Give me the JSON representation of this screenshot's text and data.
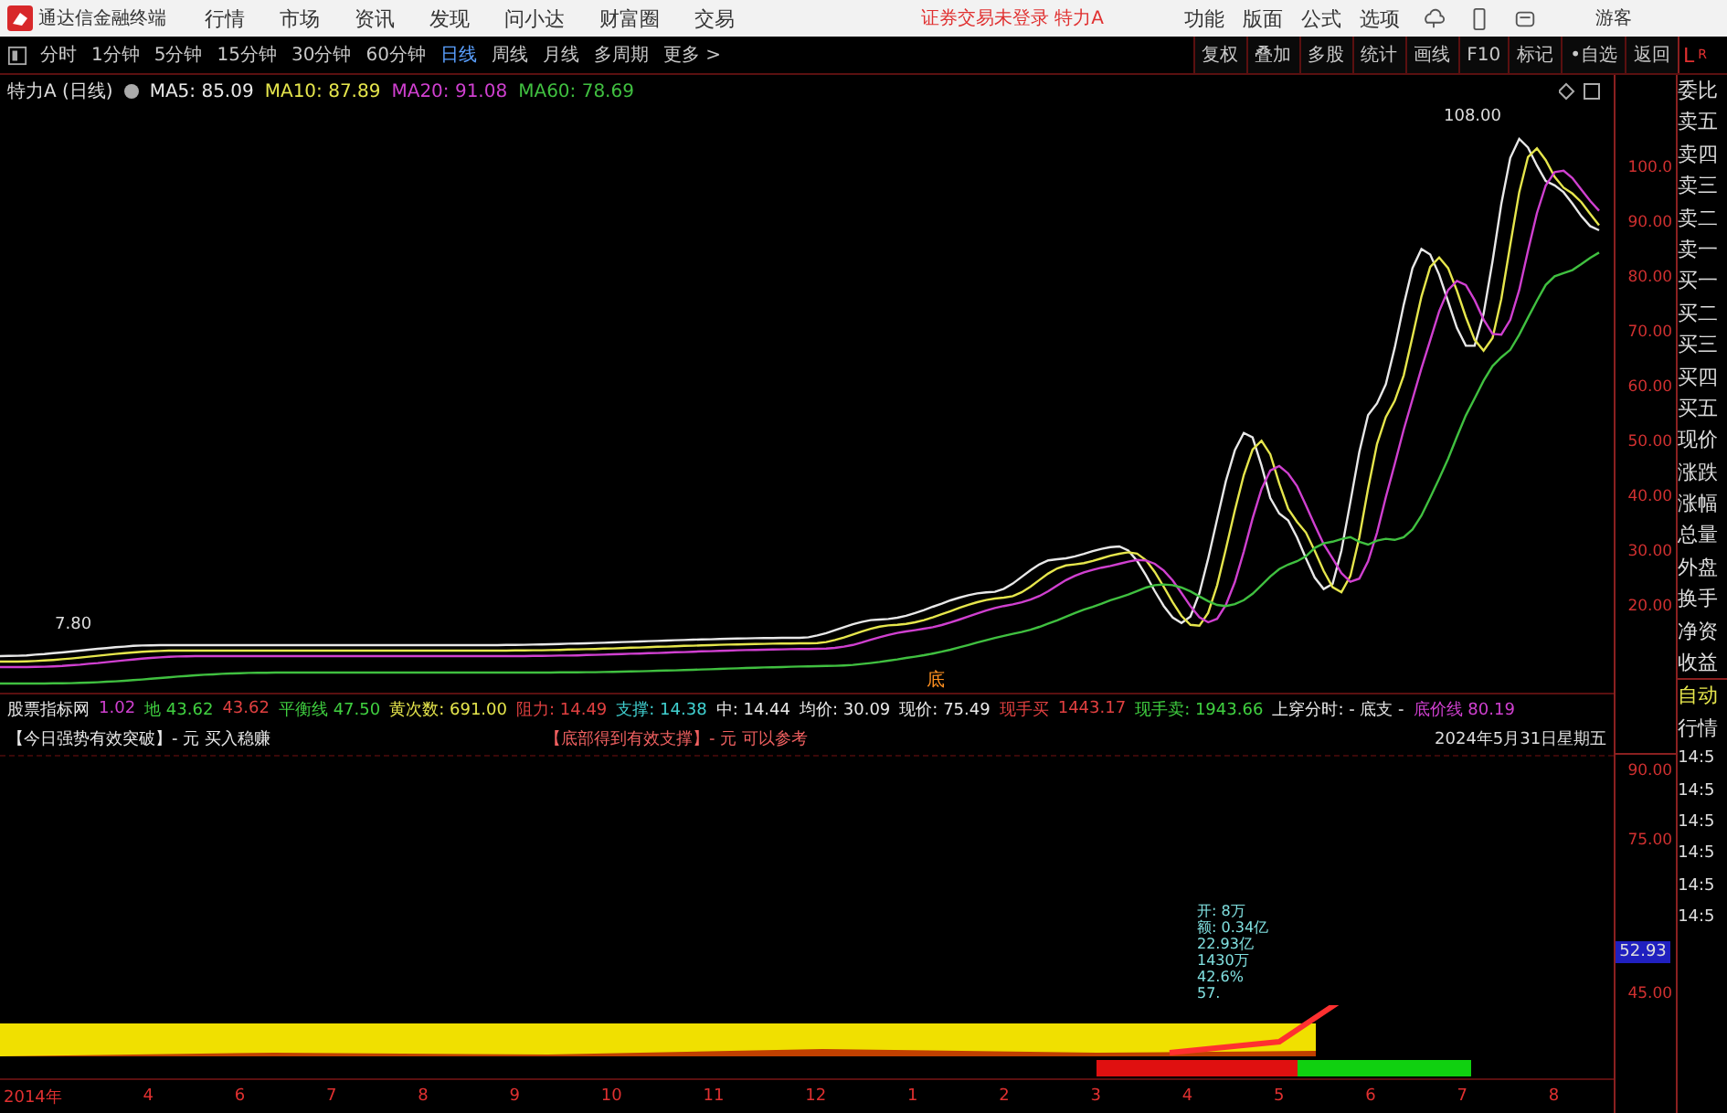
{
  "app": {
    "title": "通达信金融终端",
    "menu": [
      "行情",
      "市场",
      "资讯",
      "发现",
      "问小达",
      "财富圈",
      "交易"
    ],
    "notice": "证券交易未登录 特力A",
    "tools": [
      "功能",
      "版面",
      "公式",
      "选项"
    ],
    "user": "游客"
  },
  "periods": [
    {
      "label": "分时",
      "selected": false
    },
    {
      "label": "1分钟",
      "selected": false
    },
    {
      "label": "5分钟",
      "selected": false
    },
    {
      "label": "15分钟",
      "selected": false
    },
    {
      "label": "30分钟",
      "selected": false
    },
    {
      "label": "60分钟",
      "selected": false
    },
    {
      "label": "日线",
      "selected": true
    },
    {
      "label": "周线",
      "selected": false
    },
    {
      "label": "月线",
      "selected": false
    },
    {
      "label": "多周期",
      "selected": false
    },
    {
      "label": "更多 >",
      "selected": false
    }
  ],
  "actions": [
    "复权",
    "叠加",
    "多股",
    "统计",
    "画线",
    "F10",
    "标记",
    "•自选",
    "返回"
  ],
  "side_header": {
    "left": "L",
    "right": "R"
  },
  "chart": {
    "stock": "特力A (日线)",
    "mas": [
      {
        "label": "MA5: 85.09",
        "color": "#e8e8e8"
      },
      {
        "label": "MA10: 87.89",
        "color": "#e6e64c"
      },
      {
        "label": "MA20: 91.08",
        "color": "#d040d0"
      },
      {
        "label": "MA60: 78.69",
        "color": "#40c040"
      }
    ],
    "high_label": "108.00",
    "low_label": "7.80",
    "marker": "底",
    "yticks": [
      "100.0",
      "90.00",
      "80.00",
      "70.00",
      "60.00",
      "50.00",
      "40.00",
      "30.00",
      "20.00"
    ]
  },
  "indicator": {
    "items": [
      {
        "text": "股票指标网",
        "color": "#e8e8e8"
      },
      {
        "text": "1.02",
        "color": "#d040d0"
      },
      {
        "text": "地 43.62",
        "color": "#40d040"
      },
      {
        "text": "43.62",
        "color": "#e04040"
      },
      {
        "text": "平衡线 47.50",
        "color": "#40d040"
      },
      {
        "text": "黄次数: 691.00",
        "color": "#e6e64c"
      },
      {
        "text": "阻力: 14.49",
        "color": "#e04040"
      },
      {
        "text": "支撑: 14.38",
        "color": "#40d0d0"
      },
      {
        "text": "中: 14.44",
        "color": "#e8e8e8"
      },
      {
        "text": "均价: 30.09",
        "color": "#e8e8e8"
      },
      {
        "text": "现价: 75.49",
        "color": "#e8e8e8"
      },
      {
        "text": "现手买",
        "color": "#e04040"
      },
      {
        "text": "1443.17",
        "color": "#e04040"
      },
      {
        "text": "现手卖: 1943.66",
        "color": "#40d040"
      },
      {
        "text": "上穿分时: - 底支 -",
        "color": "#e8e8e8"
      },
      {
        "text": "底价线 80.19",
        "color": "#d040d0"
      }
    ],
    "signals": [
      {
        "text": "【今日强势有效突破】- 元 买入稳赚",
        "color": "#e8e8e8"
      },
      {
        "text": "【底部得到有效支撑】- 元 可以参考",
        "color": "#f06060"
      }
    ],
    "date": "2024年5月31日星期五"
  },
  "lower": {
    "yticks": [
      "90.00",
      "75.00",
      "45.00"
    ],
    "current": "52.93",
    "notes": [
      "开: 8万",
      "额: 0.34亿",
      "22.93亿",
      "1430万",
      "42.6%",
      "57."
    ]
  },
  "months": [
    "2014年",
    "4",
    "6",
    "7",
    "8",
    "9",
    "10",
    "11",
    "12",
    "1",
    "2",
    "3",
    "4",
    "5",
    "6",
    "7",
    "8"
  ],
  "side": [
    "委比",
    "卖五",
    "卖四",
    "卖三",
    "卖二",
    "卖一",
    "买一",
    "买二",
    "买三",
    "买四",
    "买五",
    "现价",
    "涨跌",
    "涨幅",
    "总量",
    "外盘",
    "换手",
    "净资",
    "收益"
  ],
  "side_modes": [
    "自动",
    "行情"
  ],
  "times": [
    "14:5",
    "14:5",
    "14:5",
    "14:5",
    "14:5",
    "14:5"
  ]
}
